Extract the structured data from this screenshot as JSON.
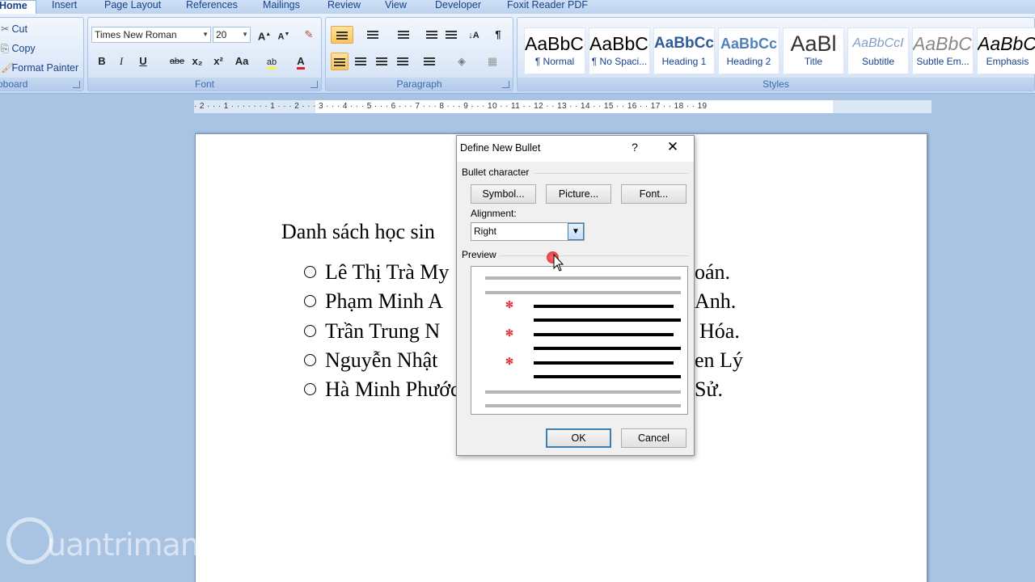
{
  "ribbon": {
    "tabs": [
      "Home",
      "Insert",
      "Page Layout",
      "References",
      "Mailings",
      "Review",
      "View",
      "Developer",
      "Foxit Reader PDF"
    ],
    "clipboard": {
      "cut": "Cut",
      "copy": "Copy",
      "format_painter": "Format Painter",
      "label": "oboard"
    },
    "font": {
      "family": "Times New Roman",
      "size": "20",
      "label": "Font",
      "grow_icon": "A",
      "shrink_icon": "A",
      "bold": "B",
      "italic": "I",
      "underline": "U",
      "strike": "abe",
      "subscript": "x₂",
      "superscript": "x²",
      "case": "Aa",
      "color_letter": "A"
    },
    "paragraph": {
      "label": "Paragraph"
    },
    "styles": {
      "label": "Styles",
      "items": [
        {
          "sample": "AaBbCcDc",
          "name": "¶ Normal"
        },
        {
          "sample": "AaBbCcDc",
          "name": "¶ No Spaci..."
        },
        {
          "sample": "AaBbCc",
          "name": "Heading 1"
        },
        {
          "sample": "AaBbCc",
          "name": "Heading 2"
        },
        {
          "sample": "AaBl",
          "name": "Title"
        },
        {
          "sample": "AaBbCcI",
          "name": "Subtitle"
        },
        {
          "sample": "AaBbCcDc",
          "name": "Subtle Em..."
        },
        {
          "sample": "AaBbCcDc",
          "name": "Emphasis"
        }
      ]
    }
  },
  "ruler": {
    "numbers": "· 2 · · · 1 · · · · · · · 1 · · · 2 · · · 3 · · · 4 · · · 5 · · · 6 · · · 7 · · · 8 · · · 9 · · · 10 · · 11 · · 12 · · 13 · · 14 · · 15 · · 16 · · 17 · · 18 · · 19"
  },
  "document": {
    "title": "Danh sách học sin",
    "items": [
      {
        "text": "Lê Thị Trà My",
        "tail": "oán."
      },
      {
        "text": "Phạm Minh A",
        "tail": "Anh."
      },
      {
        "text": "Trần Trung N",
        "tail": "Hóa."
      },
      {
        "text": "Nguyễn Nhật",
        "tail": "en Lý"
      },
      {
        "text": "Hà Minh Phước",
        "tail": "Sử."
      }
    ]
  },
  "dialog": {
    "title": "Define New Bullet",
    "help": "?",
    "close": "✕",
    "bullet_character_label": "Bullet character",
    "symbol_button": "Symbol...",
    "picture_button": "Picture...",
    "font_button": "Font...",
    "alignment_label": "Alignment:",
    "alignment_value": "Right",
    "preview_label": "Preview",
    "preview_bullet": "✻",
    "ok_button": "OK",
    "cancel_button": "Cancel"
  },
  "watermark": {
    "text": "uantrimang"
  },
  "colors": {
    "ribbon_text": "#15428b",
    "workspace": "#a9c3e3",
    "preview_bullet": "#e0303a",
    "default_button_border": "#3c7fb1",
    "cursor_highlight": "#d81b1b"
  }
}
